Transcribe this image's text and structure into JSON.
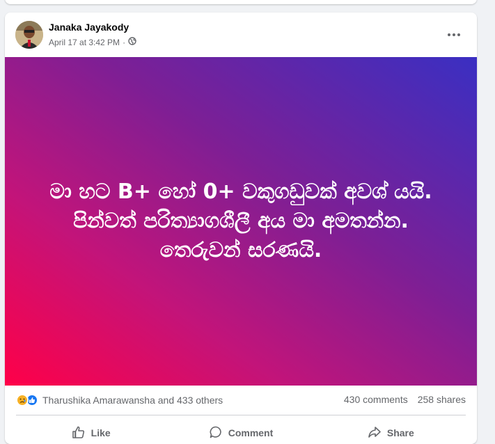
{
  "post": {
    "author": "Janaka Jayakody",
    "date": "April 17 at 3:42 PM",
    "separator": "·",
    "privacy_icon": "globe-icon",
    "content": "මා හට B+ හෝ 0+ වකුගඩුවක් අවශ් යයි. පින්වත් පරිත්‍යාගශීලී අය මා අමතන්න. තෙරුවන් සරණයි.",
    "gradient": [
      "#ff0048",
      "#c2147a",
      "#7d1f95",
      "#3a2fc2"
    ]
  },
  "stats": {
    "reactions": [
      "sad-icon",
      "like-icon"
    ],
    "reactors": "Tharushika Amarawansha and 433 others",
    "comments": "430 comments",
    "shares": "258 shares"
  },
  "actions": {
    "like": "Like",
    "comment": "Comment",
    "share": "Share"
  },
  "colors": {
    "accent": "#1877f2",
    "muted_text": "#65676b",
    "page_bg": "#f0f2f5"
  }
}
